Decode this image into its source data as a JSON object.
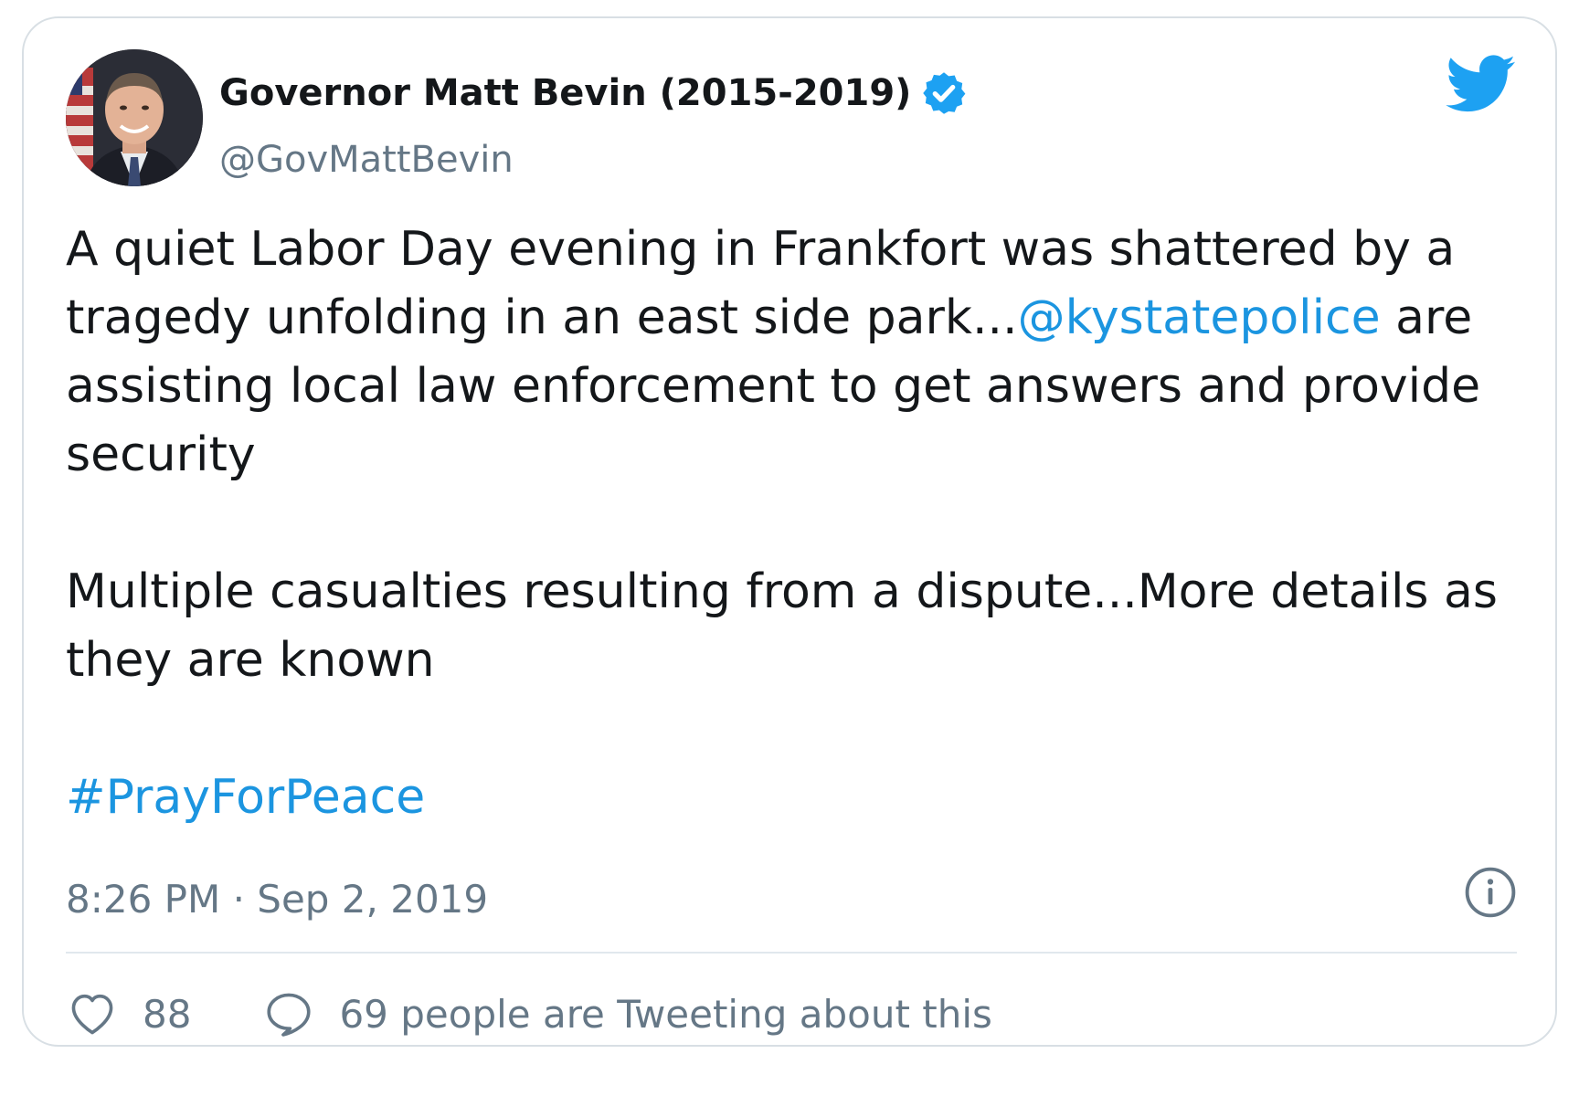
{
  "author": {
    "name": "Governor Matt Bevin (2015-2019)",
    "handle": "@GovMattBevin",
    "verified_icon": "verified-badge-icon",
    "avatar_icon": "profile-photo"
  },
  "tweet": {
    "lines_paragraph1": [
      {
        "text": "A quiet Labor Day evening in Frankfort was shattered by a"
      },
      {
        "before": "tragedy unfolding in an east side park...",
        "mention": "@kystatepolice",
        "after": " are"
      },
      {
        "text": "assisting local law enforcement to get answers and provide"
      },
      {
        "text": "security"
      }
    ],
    "lines_paragraph2": [
      {
        "text": "Multiple casualties resulting from a dispute...More details as"
      },
      {
        "text": "they are known"
      }
    ],
    "hashtag": "#PrayForPeace"
  },
  "timestamp": "8:26 PM · Sep 2, 2019",
  "actions": {
    "likes": "88",
    "reply_text": "69 people are Tweeting about this"
  },
  "icons": {
    "logo": "twitter-bird-icon",
    "info": "info-icon",
    "like": "heart-icon",
    "reply": "reply-bubble-icon"
  },
  "colors": {
    "link": "#1b95e0",
    "secondary_text": "#657786",
    "primary_text": "#14171a",
    "border": "#d8dfe4",
    "verified": "#1da1f2"
  }
}
